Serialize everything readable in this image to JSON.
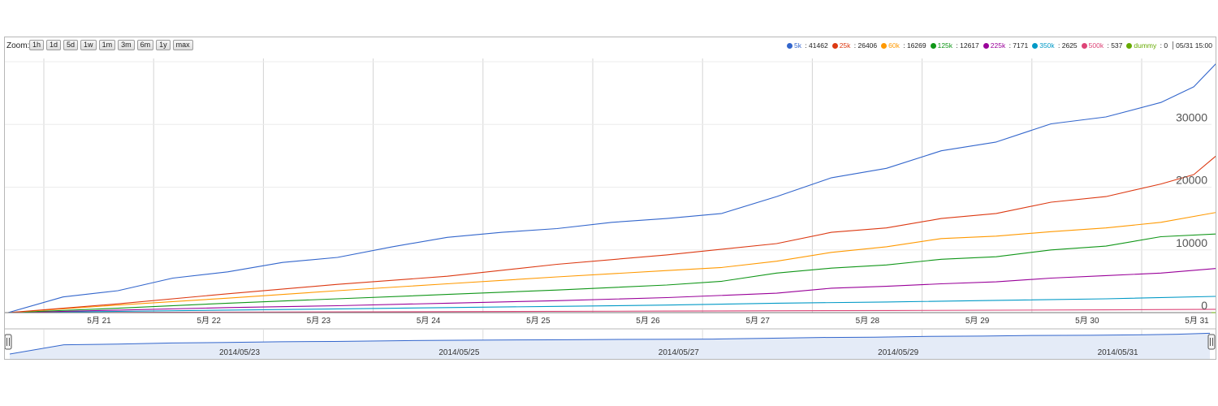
{
  "toolbar": {
    "zoom_label": "Zoom:",
    "zoom_buttons": [
      "1h",
      "1d",
      "5d",
      "1w",
      "1m",
      "3m",
      "6m",
      "1y",
      "max"
    ]
  },
  "legend": {
    "items": [
      {
        "name": "5k",
        "value": "41462",
        "color": "#3366cc"
      },
      {
        "name": "25k",
        "value": "26406",
        "color": "#dc3912"
      },
      {
        "name": "60k",
        "value": "16269",
        "color": "#ff9900"
      },
      {
        "name": "125k",
        "value": "12617",
        "color": "#109618"
      },
      {
        "name": "225k",
        "value": "7171",
        "color": "#990099"
      },
      {
        "name": "350k",
        "value": "2625",
        "color": "#0099c6"
      },
      {
        "name": "500k",
        "value": "537",
        "color": "#dd4477"
      },
      {
        "name": "dummy",
        "value": "0",
        "color": "#66aa00"
      }
    ],
    "date": "05/31 15:00"
  },
  "chart_data": {
    "type": "line",
    "ylim": [
      0,
      40000
    ],
    "yticks": [
      0,
      10000,
      20000,
      30000
    ],
    "xlim": [
      0,
      11.1
    ],
    "x_tick_labels": [
      "5月 21",
      "5月 22",
      "5月 23",
      "5月 24",
      "5月 25",
      "5月 26",
      "5月 27",
      "5月 28",
      "5月 29",
      "5月 30",
      "5月 31"
    ],
    "grid": true,
    "legend_position": "top-right",
    "series": [
      {
        "name": "5k",
        "color": "#3366cc",
        "x": [
          0,
          0.5,
          1.0,
          1.5,
          2.0,
          2.5,
          3.0,
          3.5,
          4.0,
          4.5,
          5.0,
          5.5,
          6.0,
          6.5,
          7.0,
          7.5,
          8.0,
          8.5,
          9.0,
          9.5,
          10.0,
          10.5,
          10.8,
          11.1
        ],
        "y": [
          0,
          2500,
          3500,
          5500,
          6500,
          8000,
          8800,
          10500,
          12000,
          12800,
          13400,
          14400,
          15000,
          15800,
          18500,
          21500,
          23000,
          25800,
          27200,
          30100,
          31200,
          33500,
          36000,
          41462
        ]
      },
      {
        "name": "25k",
        "color": "#dc3912",
        "x": [
          0,
          1.0,
          2.0,
          3.0,
          4.0,
          5.0,
          6.0,
          7.0,
          7.5,
          8.0,
          8.5,
          9.0,
          9.5,
          10.0,
          10.5,
          10.8,
          11.1
        ],
        "y": [
          0,
          1400,
          3000,
          4500,
          5800,
          7700,
          9200,
          11000,
          12800,
          13500,
          15000,
          15800,
          17600,
          18500,
          20500,
          22000,
          26406
        ]
      },
      {
        "name": "60k",
        "color": "#ff9900",
        "x": [
          0,
          1.0,
          2.0,
          3.0,
          4.0,
          5.0,
          6.0,
          6.5,
          7.0,
          7.5,
          8.0,
          8.5,
          9.0,
          9.5,
          10.0,
          10.5,
          11.1
        ],
        "y": [
          0,
          1200,
          2300,
          3500,
          4600,
          5700,
          6700,
          7200,
          8200,
          9600,
          10500,
          11800,
          12200,
          12900,
          13500,
          14400,
          16269
        ]
      },
      {
        "name": "125k",
        "color": "#109618",
        "x": [
          0,
          1.0,
          2.0,
          3.0,
          4.0,
          5.0,
          6.0,
          6.5,
          7.0,
          7.5,
          8.0,
          8.5,
          9.0,
          9.5,
          10.0,
          10.5,
          11.1
        ],
        "y": [
          0,
          700,
          1500,
          2200,
          2900,
          3600,
          4400,
          5000,
          6300,
          7100,
          7600,
          8500,
          8900,
          10000,
          10600,
          12100,
          12617
        ]
      },
      {
        "name": "225k",
        "color": "#990099",
        "x": [
          0,
          1.0,
          2.0,
          3.0,
          4.0,
          5.0,
          6.0,
          7.0,
          7.5,
          8.0,
          8.5,
          9.0,
          9.5,
          10.0,
          10.5,
          11.1
        ],
        "y": [
          0,
          400,
          800,
          1100,
          1500,
          1900,
          2400,
          3100,
          3900,
          4200,
          4600,
          4900,
          5500,
          5900,
          6300,
          7171
        ]
      },
      {
        "name": "350k",
        "color": "#0099c6",
        "x": [
          0,
          1.0,
          2.0,
          3.0,
          4.0,
          5.0,
          6.0,
          7.0,
          8.0,
          9.0,
          10.0,
          11.1
        ],
        "y": [
          0,
          200,
          400,
          600,
          800,
          1000,
          1200,
          1500,
          1700,
          1950,
          2200,
          2625
        ]
      },
      {
        "name": "500k",
        "color": "#dd4477",
        "x": [
          0,
          2.0,
          4.0,
          6.0,
          8.0,
          10.0,
          11.1
        ],
        "y": [
          0,
          80,
          160,
          250,
          340,
          440,
          537
        ]
      },
      {
        "name": "dummy",
        "color": "#66aa00",
        "x": [
          0,
          11.1
        ],
        "y": [
          0,
          0
        ]
      }
    ],
    "navigator": {
      "labels": [
        "2014/05/23",
        "2014/05/25",
        "2014/05/27",
        "2014/05/29",
        "2014/05/31"
      ],
      "label_positions": [
        3,
        5,
        7,
        9,
        11
      ],
      "range": [
        -0.4,
        11.1
      ]
    }
  }
}
